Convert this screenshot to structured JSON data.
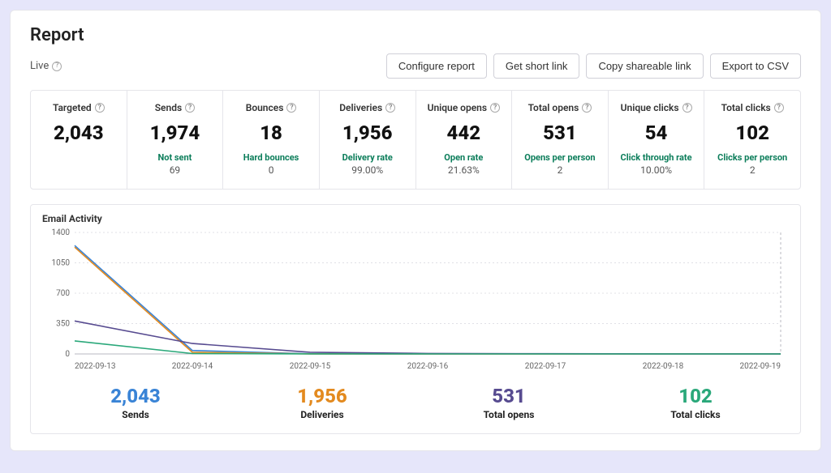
{
  "title": "Report",
  "status_label": "Live",
  "actions": {
    "configure": "Configure report",
    "short_link": "Get short link",
    "shareable": "Copy shareable link",
    "export": "Export to CSV"
  },
  "metrics": [
    {
      "label": "Targeted",
      "value": "2,043",
      "sublabel": "",
      "subvalue": ""
    },
    {
      "label": "Sends",
      "value": "1,974",
      "sublabel": "Not sent",
      "subvalue": "69"
    },
    {
      "label": "Bounces",
      "value": "18",
      "sublabel": "Hard bounces",
      "subvalue": "0"
    },
    {
      "label": "Deliveries",
      "value": "1,956",
      "sublabel": "Delivery rate",
      "subvalue": "99.00%"
    },
    {
      "label": "Unique opens",
      "value": "442",
      "sublabel": "Open rate",
      "subvalue": "21.63%"
    },
    {
      "label": "Total opens",
      "value": "531",
      "sublabel": "Opens per person",
      "subvalue": "2"
    },
    {
      "label": "Unique clicks",
      "value": "54",
      "sublabel": "Click through rate",
      "subvalue": "10.00%"
    },
    {
      "label": "Total clicks",
      "value": "102",
      "sublabel": "Clicks per person",
      "subvalue": "2"
    }
  ],
  "chart_title": "Email Activity",
  "chart_data": {
    "type": "line",
    "xlabel": "",
    "ylabel": "",
    "ylim": [
      0,
      1400
    ],
    "yticks": [
      0,
      350,
      700,
      1050,
      1400
    ],
    "categories": [
      "2022-09-13",
      "2022-09-14",
      "2022-09-15",
      "2022-09-16",
      "2022-09-17",
      "2022-09-18",
      "2022-09-19"
    ],
    "series": [
      {
        "name": "Sends",
        "color": "#3a84d6",
        "values": [
          1250,
          40,
          2,
          0,
          0,
          0,
          0
        ]
      },
      {
        "name": "Deliveries",
        "color": "#e38a1f",
        "values": [
          1230,
          20,
          1,
          0,
          0,
          0,
          0
        ]
      },
      {
        "name": "Total opens",
        "color": "#574b90",
        "values": [
          380,
          120,
          20,
          6,
          3,
          1,
          1
        ]
      },
      {
        "name": "Total clicks",
        "color": "#2aa87a",
        "values": [
          150,
          5,
          1,
          0,
          0,
          0,
          0
        ]
      }
    ]
  },
  "summary": [
    {
      "key": "sends",
      "value": "2,043",
      "label": "Sends",
      "class": "c-sends"
    },
    {
      "key": "deliveries",
      "value": "1,956",
      "label": "Deliveries",
      "class": "c-deliveries"
    },
    {
      "key": "opens",
      "value": "531",
      "label": "Total opens",
      "class": "c-opens"
    },
    {
      "key": "clicks",
      "value": "102",
      "label": "Total clicks",
      "class": "c-clicks"
    }
  ]
}
